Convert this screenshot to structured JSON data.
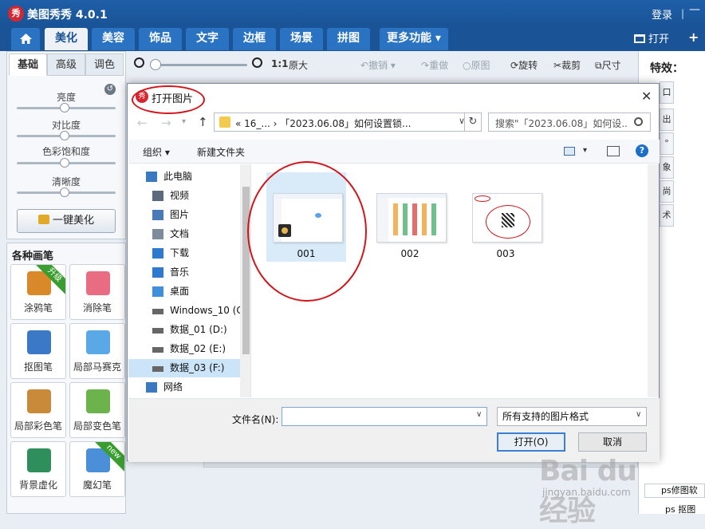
{
  "app": {
    "logo_text": "秀",
    "title": "美图秀秀 4.0.1",
    "login": "登录",
    "min_glyph": "—"
  },
  "tabs": [
    "美化",
    "美容",
    "饰品",
    "文字",
    "边框",
    "场景",
    "拼图",
    "更多功能 ▾"
  ],
  "top_actions": {
    "open": "打开",
    "new_glyph": "+"
  },
  "toolbar": {
    "zoom_ratio": "1:1",
    "original_size": "原大",
    "undo": "撤销",
    "redo": "重做",
    "original": "原图",
    "rotate": "旋转",
    "crop": "裁剪",
    "resize": "尺寸"
  },
  "left_panel": {
    "tabs": [
      "基础",
      "高级",
      "调色"
    ],
    "sliders": [
      {
        "label": "亮度",
        "level": 0.5
      },
      {
        "label": "对比度",
        "level": 0.5
      },
      {
        "label": "色彩饱和度",
        "level": 0.5
      },
      {
        "label": "清晰度",
        "level": 0.5
      }
    ],
    "beautify_button": "一键美化"
  },
  "brush_panel": {
    "heading": "各种画笔",
    "tools": [
      {
        "label": "涂鸦笔",
        "icon": "brush-icon",
        "ribbon": "升级"
      },
      {
        "label": "消除笔",
        "icon": "eraser-icon",
        "ribbon": ""
      },
      {
        "label": "抠图笔",
        "icon": "cutout-pen-icon",
        "ribbon": ""
      },
      {
        "label": "局部马赛克",
        "icon": "mosaic-icon",
        "ribbon": ""
      },
      {
        "label": "局部彩色笔",
        "icon": "color-brush-icon",
        "ribbon": ""
      },
      {
        "label": "局部变色笔",
        "icon": "recolor-pen-icon",
        "ribbon": ""
      },
      {
        "label": "背景虚化",
        "icon": "blur-background-icon",
        "ribbon": ""
      },
      {
        "label": "魔幻笔",
        "icon": "magic-wand-icon",
        "ribbon": "new"
      }
    ]
  },
  "right_panel": {
    "title": "特效：",
    "buttons": [
      "口",
      "出",
      "°",
      "象",
      "尚",
      "术"
    ],
    "item1": "ps修图软",
    "item2": "ps 抠图"
  },
  "dialog": {
    "title": "打开图片",
    "address": "«  16_...  ›  「2023.06.08」如何设置锁...",
    "search_placeholder": "搜索\"「2023.06.08」如何设...",
    "organize": "组织 ▾",
    "new_folder": "新建文件夹",
    "nav_items": [
      {
        "label": "此电脑",
        "icon": "computer-icon",
        "indent": 0
      },
      {
        "label": "视频",
        "icon": "video-folder-icon",
        "indent": 1
      },
      {
        "label": "图片",
        "icon": "pictures-folder-icon",
        "indent": 1
      },
      {
        "label": "文档",
        "icon": "documents-folder-icon",
        "indent": 1
      },
      {
        "label": "下载",
        "icon": "download-icon",
        "indent": 1
      },
      {
        "label": "音乐",
        "icon": "music-icon",
        "indent": 1
      },
      {
        "label": "桌面",
        "icon": "desktop-icon",
        "indent": 1
      },
      {
        "label": "Windows_10 (C",
        "icon": "drive-icon",
        "indent": 1
      },
      {
        "label": "数据_01 (D:)",
        "icon": "drive-icon",
        "indent": 1
      },
      {
        "label": "数据_02 (E:)",
        "icon": "drive-icon",
        "indent": 1
      },
      {
        "label": "数据_03 (F:)",
        "icon": "drive-icon",
        "indent": 1,
        "selected": true
      },
      {
        "label": "网络",
        "icon": "network-icon",
        "indent": 0
      }
    ],
    "files": [
      {
        "name": "001",
        "selected": true
      },
      {
        "name": "002",
        "selected": false
      },
      {
        "name": "003",
        "selected": false
      }
    ],
    "filename_label": "文件名(N):",
    "filename_value": "",
    "filetype": "所有支持的图片格式",
    "open_button": "打开(O)",
    "cancel_button": "取消",
    "close_glyph": "✕"
  },
  "watermark": {
    "text": "Bai du 经验",
    "url": "jingyan.baidu.com"
  },
  "colors": {
    "accent": "#1a5396",
    "tab": "#2a73c3",
    "annotation_red": "#d3141b",
    "ribbon_green": "#3a9d2f"
  }
}
